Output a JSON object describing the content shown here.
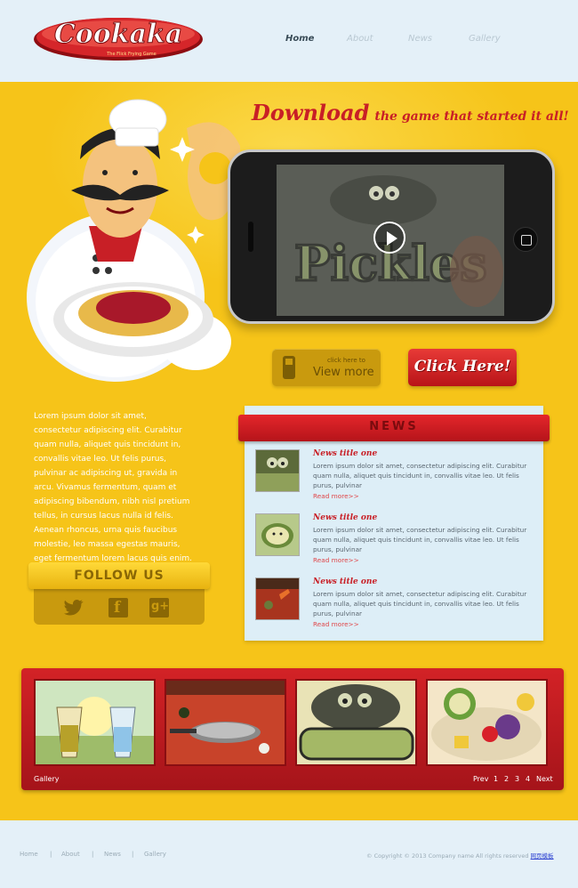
{
  "header": {
    "logo_text": "Cookaka",
    "logo_tagline": "The Flick Frying Game",
    "nav": [
      {
        "label": "Home",
        "active": true
      },
      {
        "label": "About",
        "active": false
      },
      {
        "label": "News",
        "active": false
      },
      {
        "label": "Gallery",
        "active": false
      }
    ]
  },
  "hero": {
    "title_big": "Download",
    "title_small": "the game that started it all!",
    "video_label": "Pickles",
    "play_icon": "play-icon",
    "view_more": {
      "small": "click here to",
      "big": "View more"
    },
    "click_here": "Click Here!"
  },
  "about": {
    "text": "Lorem ipsum dolor sit amet, consectetur adipiscing elit. Curabitur quam nulla, aliquet quis tincidunt in, convallis vitae leo. Ut felis purus, pulvinar ac adipiscing ut, gravida in arcu. Vivamus fermentum, quam et adipiscing bibendum, nibh nisl pretium tellus, in cursus lacus nulla id felis. Aenean rhoncus, urna quis faucibus molestie, leo massa egestas mauris, eget fermentum lorem lacus quis enim."
  },
  "follow": {
    "title": "FOLLOW US",
    "icons": [
      "twitter-icon",
      "facebook-icon",
      "google-plus-icon"
    ]
  },
  "news": {
    "title": "NEWS",
    "items": [
      {
        "title": "News title one",
        "body": "Lorem ipsum dolor sit amet, consectetur adipiscing elit. Curabitur quam nulla, aliquet quis tincidunt in, convallis vitae leo. Ut felis purus, pulvinar",
        "more": "Read more>>"
      },
      {
        "title": "News title one",
        "body": "Lorem ipsum dolor sit amet, consectetur adipiscing elit. Curabitur quam nulla, aliquet quis tincidunt in, convallis vitae leo. Ut felis purus, pulvinar",
        "more": "Read more>>"
      },
      {
        "title": "News title one",
        "body": "Lorem ipsum dolor sit amet, consectetur adipiscing elit. Curabitur quam nulla, aliquet quis tincidunt in, convallis vitae leo. Ut felis purus, pulvinar",
        "more": "Read more>>"
      }
    ]
  },
  "gallery": {
    "label": "Gallery",
    "pager": {
      "prev": "Prev",
      "pages": [
        "1",
        "2",
        "3",
        "4"
      ],
      "next": "Next"
    },
    "images": [
      "drinks",
      "frying-pan",
      "pickles",
      "fruit"
    ]
  },
  "footer": {
    "links": [
      "Home",
      "About",
      "News",
      "Gallery"
    ],
    "separator": "|",
    "copyright": "© Copyright © 2013 Company name All rights reserved",
    "copyright_link": "网页模板"
  },
  "colors": {
    "yellow": "#f6c419",
    "red": "#c81f26",
    "header_bg": "#e4f0f8"
  }
}
